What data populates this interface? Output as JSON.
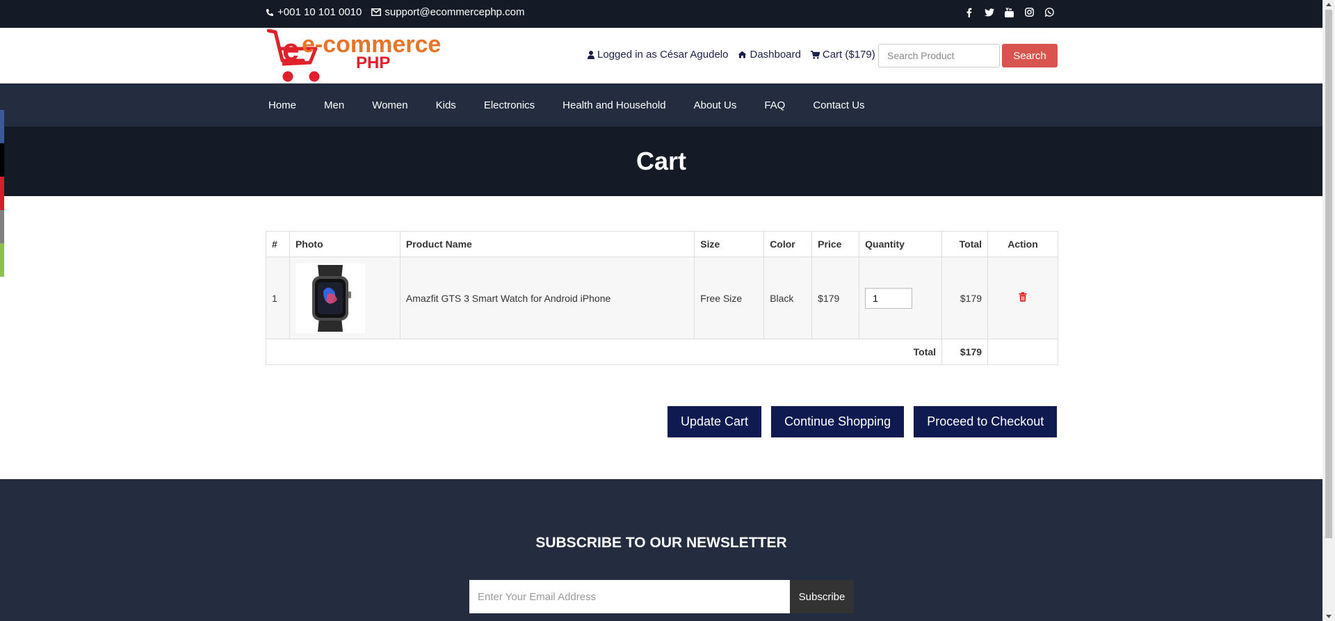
{
  "topbar": {
    "phone": "+001 10 101 0010",
    "email": "support@ecommercephp.com",
    "social_icons": [
      "facebook-icon",
      "twitter-icon",
      "youtube-icon",
      "instagram-icon",
      "whatsapp-icon"
    ]
  },
  "header": {
    "logo_text_main": "e-commerce",
    "logo_text_sub": "PHP",
    "logged_in": "Logged in as César Agudelo",
    "dashboard": "Dashboard",
    "cart": "Cart ($179)",
    "search_placeholder": "Search Product",
    "search_button": "Search"
  },
  "nav": {
    "items": [
      "Home",
      "Men",
      "Women",
      "Kids",
      "Electronics",
      "Health and Household",
      "About Us",
      "FAQ",
      "Contact Us"
    ]
  },
  "page": {
    "title": "Cart"
  },
  "cart_table": {
    "headers": [
      "#",
      "Photo",
      "Product Name",
      "Size",
      "Color",
      "Price",
      "Quantity",
      "Total",
      "Action"
    ],
    "rows": [
      {
        "index": "1",
        "product_name": "Amazfit GTS 3 Smart Watch for Android iPhone",
        "size": "Free Size",
        "color": "Black",
        "price": "$179",
        "quantity": "1",
        "total": "$179"
      }
    ],
    "total_label": "Total",
    "total_value": "$179"
  },
  "buttons": {
    "update": "Update Cart",
    "continue": "Continue Shopping",
    "checkout": "Proceed to Checkout"
  },
  "newsletter": {
    "title": "SUBSCRIBE TO OUR NEWSLETTER",
    "placeholder": "Enter Your Email Address",
    "button": "Subscribe"
  },
  "colors": {
    "topbar": "#151b26",
    "nav": "#232d3f",
    "search_button": "#d9534f",
    "primary_button": "#0f1a50",
    "logo_red": "#e0202a",
    "logo_orange": "#e8742a",
    "share_bar": [
      "#3b5998",
      "#000000",
      "#d0202a",
      "#808080",
      "#8bc34a"
    ]
  }
}
